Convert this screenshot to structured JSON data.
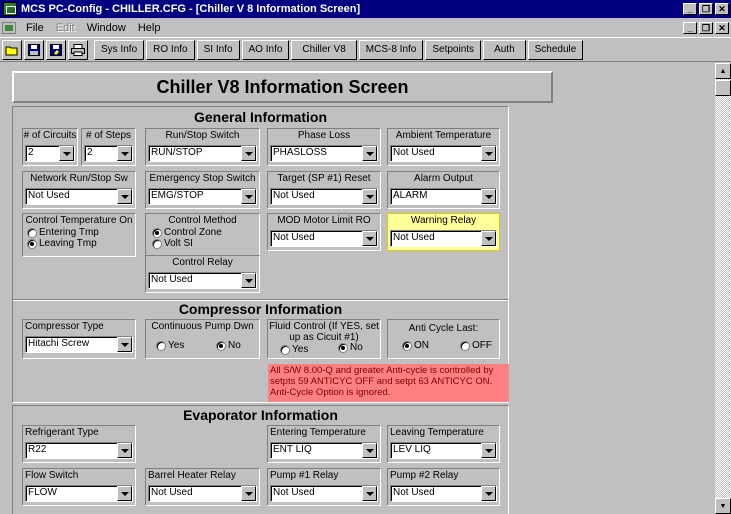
{
  "window": {
    "title": "MCS PC-Config - CHILLER.CFG - [Chiller V 8 Information Screen]"
  },
  "menu": {
    "items": [
      {
        "label": "File",
        "disabled": false
      },
      {
        "label": "Edit",
        "disabled": true
      },
      {
        "label": "Window",
        "disabled": false
      },
      {
        "label": "Help",
        "disabled": false
      }
    ]
  },
  "toolbar": {
    "icons": [
      "open-icon",
      "save-icon",
      "save-as-icon",
      "print-icon"
    ],
    "buttons": [
      "Sys Info",
      "RO Info",
      "SI Info",
      "AO Info",
      "Chiller V8",
      "MCS-8 Info",
      "Setpoints",
      "Auth",
      "Schedule"
    ]
  },
  "screen_title": "Chiller V8 Information Screen",
  "sections": {
    "general": "General Information",
    "compressor": "Compressor Information",
    "evaporator": "Evaporator Information"
  },
  "fields": {
    "circuits": {
      "label": "# of Circuits",
      "value": "2"
    },
    "steps": {
      "label": "# of Steps",
      "value": "2"
    },
    "run_stop_switch": {
      "label": "Run/Stop Switch",
      "value": "RUN/STOP"
    },
    "phase_loss": {
      "label": "Phase Loss",
      "value": "PHASLOSS"
    },
    "ambient_temp": {
      "label": "Ambient Temperature",
      "value": "Not Used"
    },
    "network_run_stop": {
      "label": "Network Run/Stop Sw",
      "value": "Not Used"
    },
    "emg_stop_switch": {
      "label": "Emergency Stop Switch",
      "value": "EMG/STOP"
    },
    "target_reset": {
      "label": "Target (SP #1) Reset",
      "value": "Not Used"
    },
    "alarm_output": {
      "label": "Alarm Output",
      "value": "ALARM"
    },
    "control_temp_on": {
      "label": "Control Temperature On",
      "options": [
        "Entering Tmp",
        "Leaving Tmp"
      ],
      "selected": 1
    },
    "control_method": {
      "label": "Control Method",
      "options": [
        "Control Zone",
        "Volt SI"
      ],
      "selected": 0
    },
    "mod_motor_limit": {
      "label": "MOD Motor Limit RO",
      "value": "Not Used"
    },
    "warning_relay": {
      "label": "Warning Relay",
      "value": "Not Used"
    },
    "control_relay": {
      "label": "Control Relay",
      "value": "Not Used"
    },
    "compressor_type": {
      "label": "Compressor Type",
      "value": "Hitachi Screw"
    },
    "continuous_pump": {
      "label": "Continuous Pump Dwn",
      "options": [
        "Yes",
        "No"
      ],
      "selected": 1
    },
    "fluid_control": {
      "label_line1": "Fluid Control (If YES, set",
      "label_line2": "up as Cicuit #1)",
      "options": [
        "Yes",
        "No"
      ],
      "selected": 1
    },
    "anti_cycle_last": {
      "label": "Anti Cycle Last:",
      "options": [
        "ON",
        "OFF"
      ],
      "selected": 0
    },
    "refrigerant_type": {
      "label": "Refrigerant Type",
      "value": "R22"
    },
    "entering_temp": {
      "label": "Entering Temperature",
      "value": "ENT LIQ"
    },
    "leaving_temp": {
      "label": "Leaving Temperature",
      "value": "LEV LIQ"
    },
    "flow_switch": {
      "label": "Flow Switch",
      "value": "FLOW"
    },
    "barrel_heater": {
      "label": "Barrel Heater Relay",
      "value": "Not Used"
    },
    "pump1_relay": {
      "label": "Pump #1 Relay",
      "value": "Not Used"
    },
    "pump2_relay": {
      "label": "Pump #2 Relay",
      "value": "Not Used"
    }
  },
  "anti_cycle_note": "All S/W 8.00-Q and greater  Anti-cycle is controlled by setpts 59 ANTICYC OFF and setpt 63 ANTICYC ON. Anti-Cycle Option is ignored.",
  "colors": {
    "titlebar": "#000080",
    "warning_highlight": "#ffff99",
    "note_bg": "#ff8080",
    "note_text": "#800000"
  }
}
